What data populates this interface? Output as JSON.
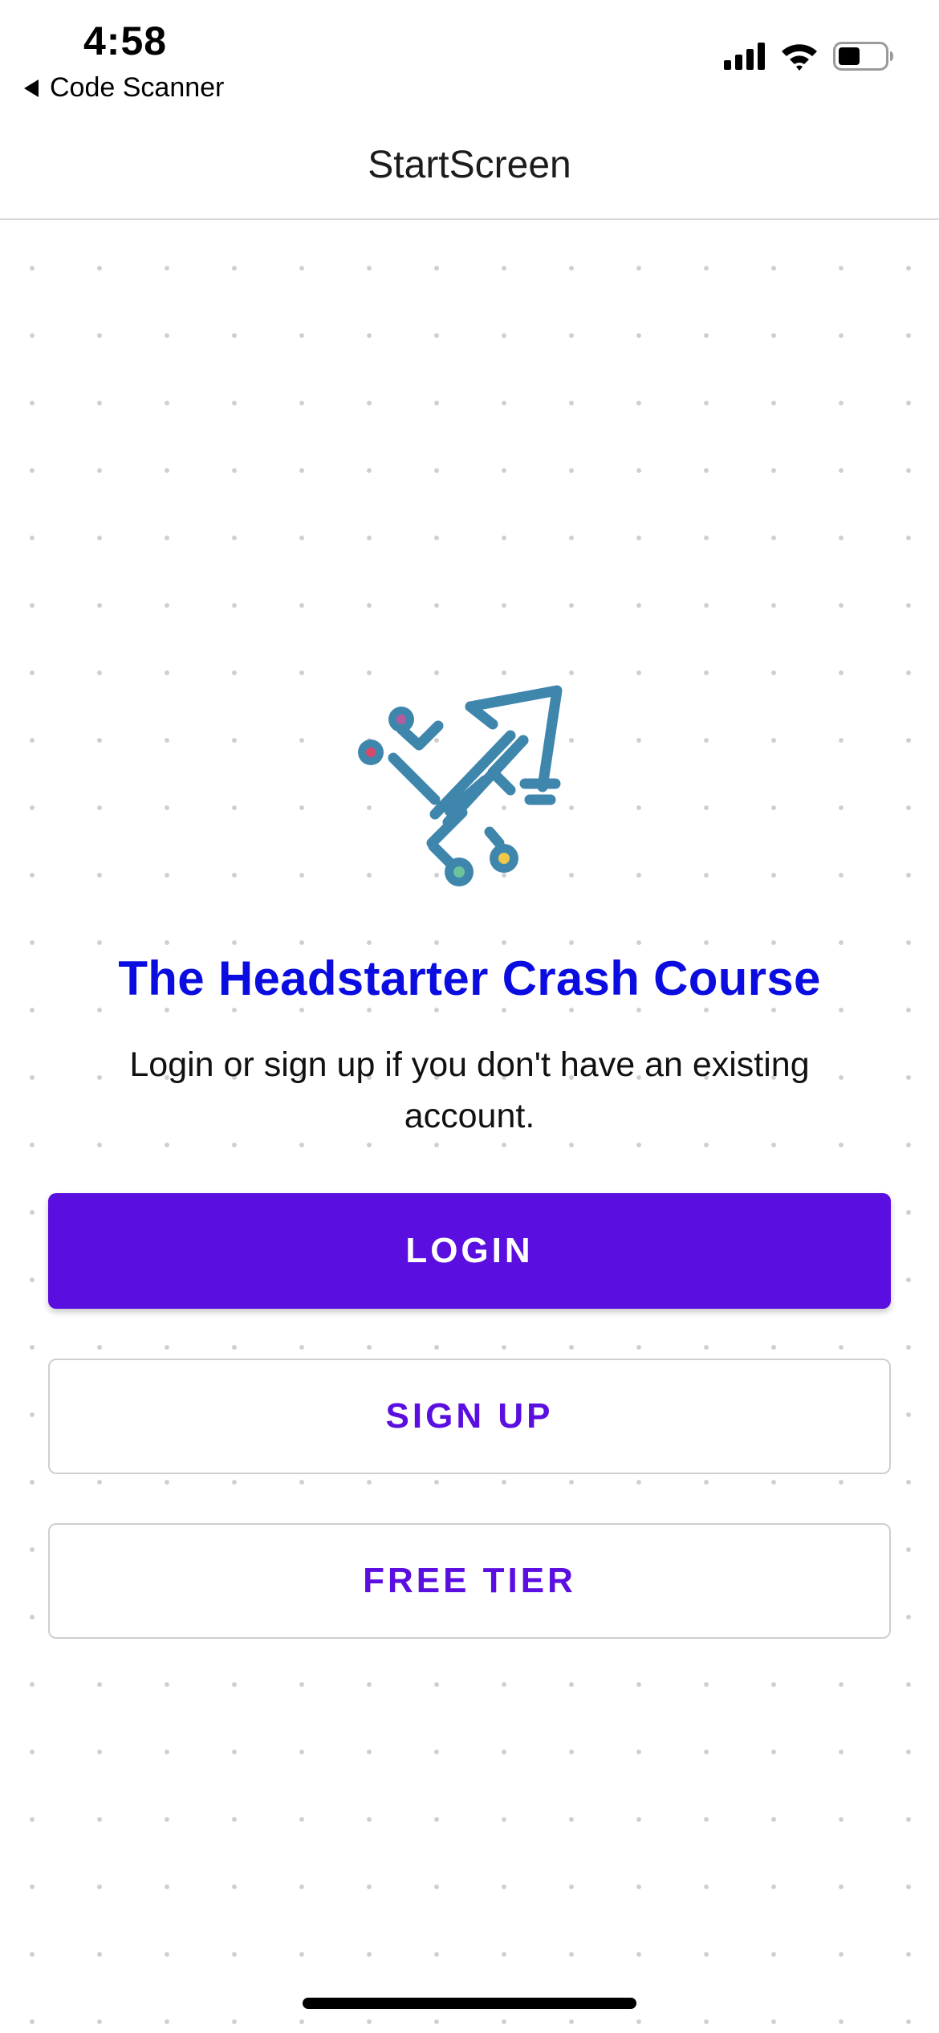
{
  "status_bar": {
    "time": "4:58",
    "back_label": "Code Scanner",
    "icons": [
      "cellular-signal-icon",
      "wifi-icon",
      "battery-icon"
    ]
  },
  "nav": {
    "title": "StartScreen"
  },
  "hero": {
    "logo_icon": "rocket-circuit-icon",
    "title": "The Headstarter Crash Course",
    "subtitle": "Login or sign up if you don't have an existing account."
  },
  "actions": {
    "login_label": "LOGIN",
    "signup_label": "SIGN UP",
    "free_tier_label": "FREE TIER"
  },
  "colors": {
    "accent": "#5a0ee0",
    "title": "#0a0ce0",
    "logo": "#3f86ad"
  }
}
